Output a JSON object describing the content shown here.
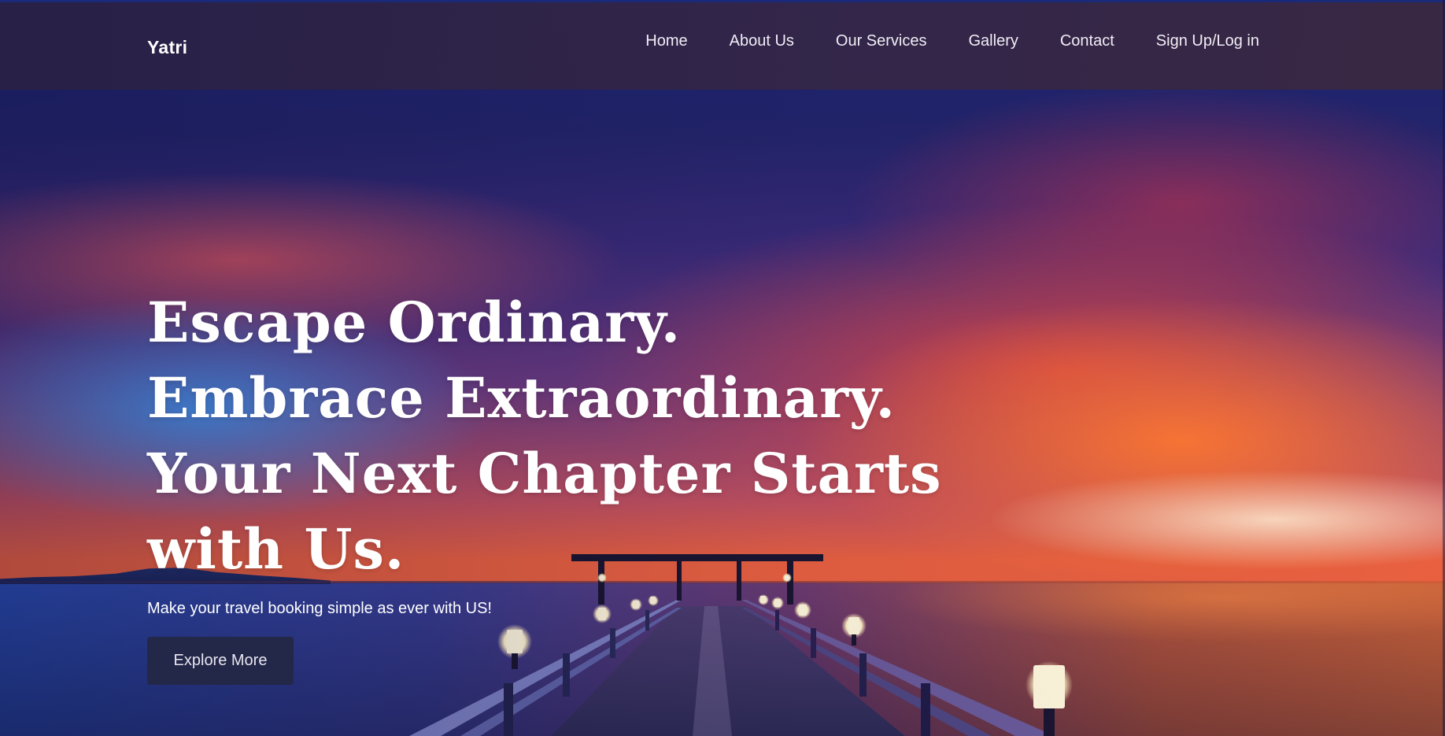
{
  "header": {
    "brand": "Yatri",
    "nav": [
      {
        "label": "Home"
      },
      {
        "label": "About Us"
      },
      {
        "label": "Our Services"
      },
      {
        "label": "Gallery"
      },
      {
        "label": "Contact"
      },
      {
        "label": "Sign Up/Log in"
      }
    ]
  },
  "hero": {
    "headline_lines": [
      "Escape Ordinary.",
      "Embrace Extraordinary.",
      "Your Next Chapter Starts",
      "with Us."
    ],
    "subtext": "Make your travel booking simple as ever with US!",
    "cta_label": "Explore More",
    "background_image": "sunset-pier-over-sea",
    "colors": {
      "header_bg": "#2e2446",
      "cta_bg": "#232748",
      "text": "#ffffff"
    }
  }
}
